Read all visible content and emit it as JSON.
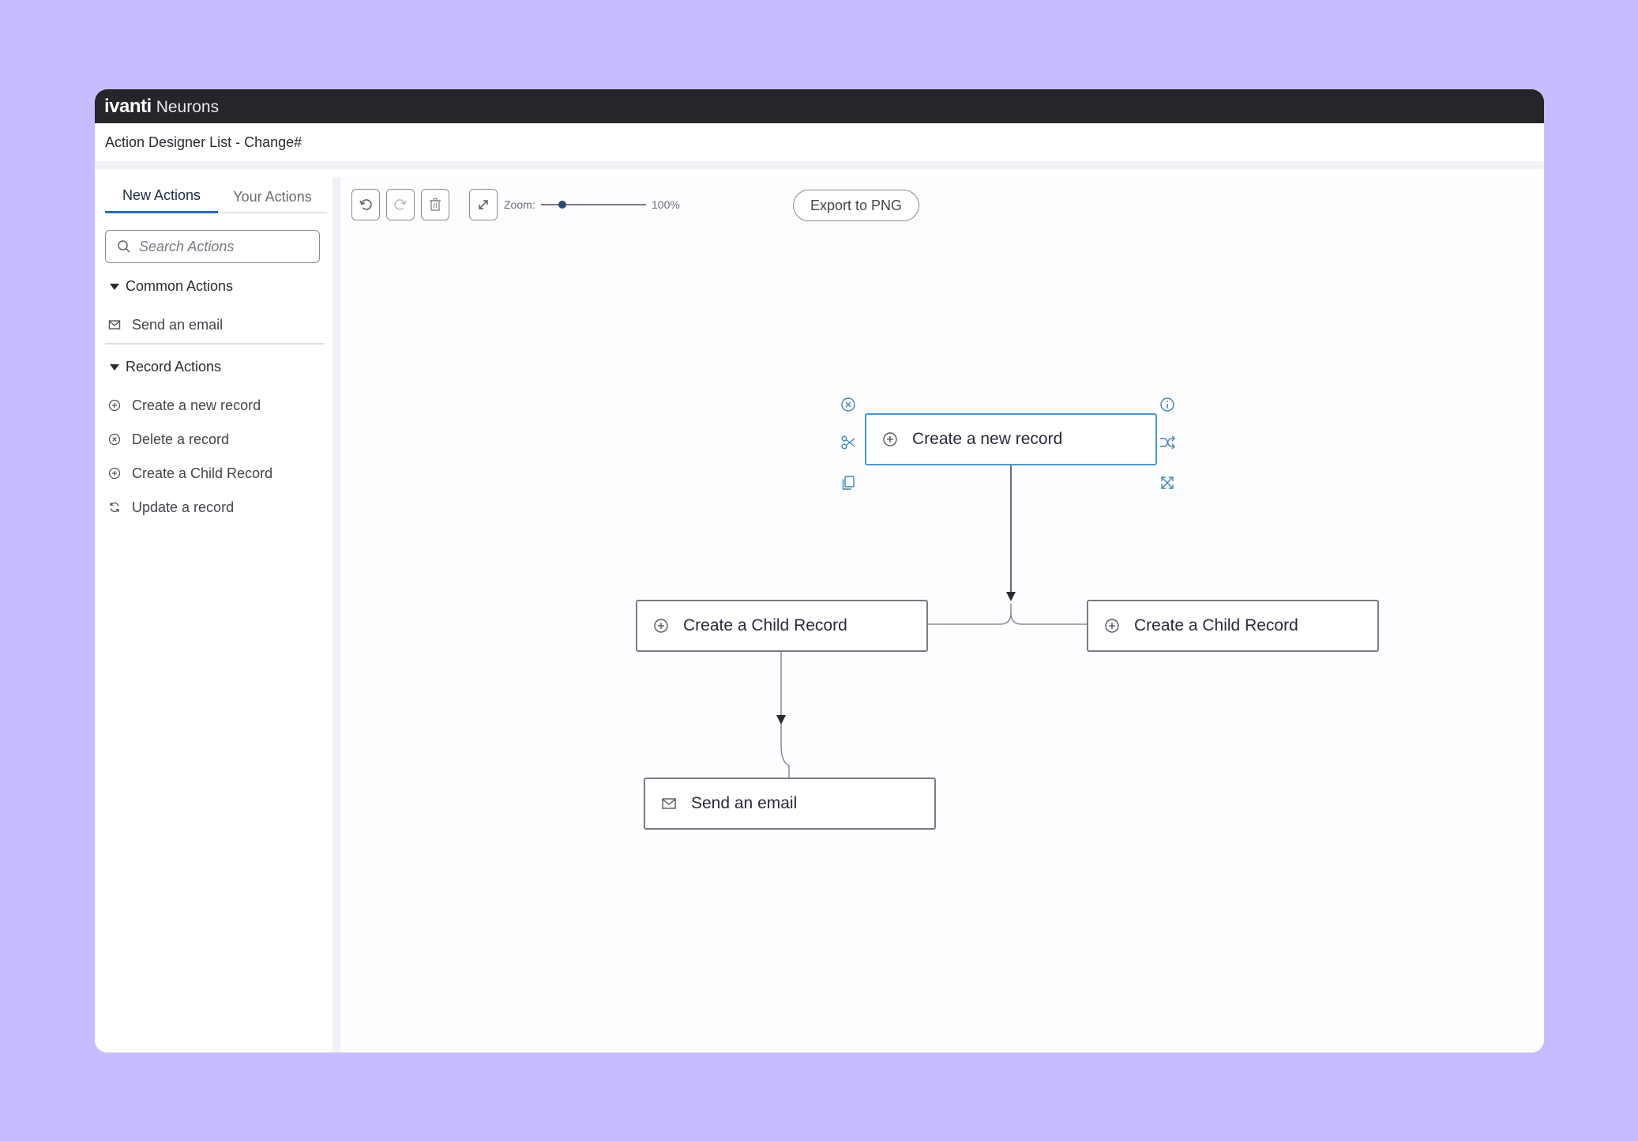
{
  "header": {
    "brand": "ivanti",
    "product": "Neurons"
  },
  "page": {
    "title": "Action Designer List - Change#"
  },
  "sidebar": {
    "tabs": [
      {
        "label": "New Actions",
        "active": true
      },
      {
        "label": "Your Actions",
        "active": false
      }
    ],
    "search": {
      "placeholder": "Search Actions",
      "value": ""
    },
    "sections": [
      {
        "title": "Common Actions",
        "expanded": true,
        "items": [
          {
            "label": "Send an email",
            "icon": "mail-icon"
          }
        ]
      },
      {
        "title": "Record Actions",
        "expanded": true,
        "items": [
          {
            "label": "Create a new record",
            "icon": "plus-circle-icon"
          },
          {
            "label": "Delete a record",
            "icon": "x-circle-icon"
          },
          {
            "label": "Create a Child Record",
            "icon": "plus-circle-icon"
          },
          {
            "label": "Update a record",
            "icon": "refresh-icon"
          }
        ]
      }
    ]
  },
  "toolbar": {
    "undo_icon": "undo-icon",
    "redo_icon": "redo-icon",
    "delete_icon": "trash-icon",
    "fit_icon": "expand-icon",
    "zoom_label": "Zoom:",
    "zoom_value": "100%",
    "zoom_level": 0.2,
    "export_label": "Export to PNG"
  },
  "diagram": {
    "nodes": [
      {
        "id": "n1",
        "label": "Create a new record",
        "icon": "plus-circle-icon",
        "selected": true
      },
      {
        "id": "n2",
        "label": "Create a Child Record",
        "icon": "plus-circle-icon",
        "selected": false
      },
      {
        "id": "n3",
        "label": "Create a Child Record",
        "icon": "plus-circle-icon",
        "selected": false
      },
      {
        "id": "n4",
        "label": "Send an email",
        "icon": "mail-icon",
        "selected": false
      }
    ],
    "edges": [
      {
        "from": "n1",
        "to": "n2"
      },
      {
        "from": "n1",
        "to": "n3"
      },
      {
        "from": "n2",
        "to": "n4"
      }
    ],
    "selected_node_actions": [
      "close-icon",
      "info-icon",
      "scissors-icon",
      "shuffle-icon",
      "copy-icon",
      "expand-arrows-icon"
    ]
  },
  "colors": {
    "background": "#c5bdfd",
    "topbar": "#272529",
    "accent": "#2b6cb0",
    "selection": "#4d98c4"
  }
}
